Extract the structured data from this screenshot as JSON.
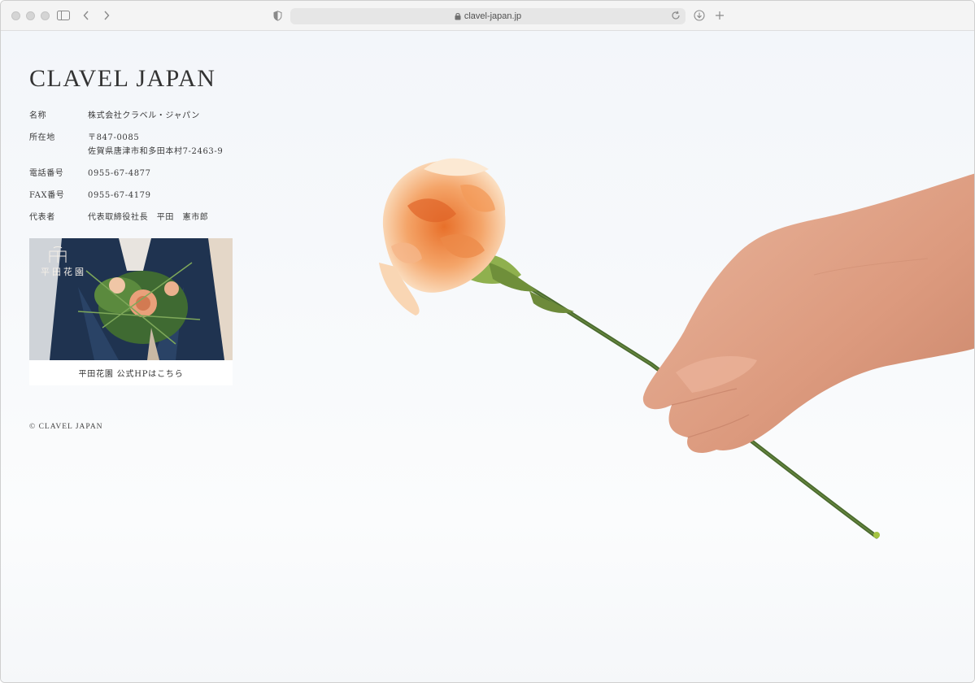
{
  "browser": {
    "url": "clavel-japan.jp"
  },
  "page": {
    "brand": "CLAVEL JAPAN",
    "info": [
      {
        "label": "名称",
        "value": "株式会社クラベル・ジャパン"
      },
      {
        "label": "所在地",
        "value": "〒847-0085\n佐賀県唐津市和多田本村7-2463-9"
      },
      {
        "label": "電話番号",
        "value": "0955-67-4877"
      },
      {
        "label": "FAX番号",
        "value": "0955-67-4179"
      },
      {
        "label": "代表者",
        "value": "代表取締役社長　平田　憲市郎"
      }
    ],
    "card": {
      "logo_text": "平田花園",
      "caption": "平田花園 公式HPはこちら"
    },
    "copyright": "© CLAVEL JAPAN"
  },
  "colors": {
    "chrome_bg": "#f4f4f4",
    "text": "#333333",
    "carnation": "#f0a060",
    "stem": "#4a6a2e",
    "skin": "#e0a58a"
  },
  "icons": [
    "sidebar-icon",
    "chevron-left-icon",
    "chevron-right-icon",
    "shield-icon",
    "lock-icon",
    "reload-icon",
    "download-icon",
    "plus-icon"
  ]
}
